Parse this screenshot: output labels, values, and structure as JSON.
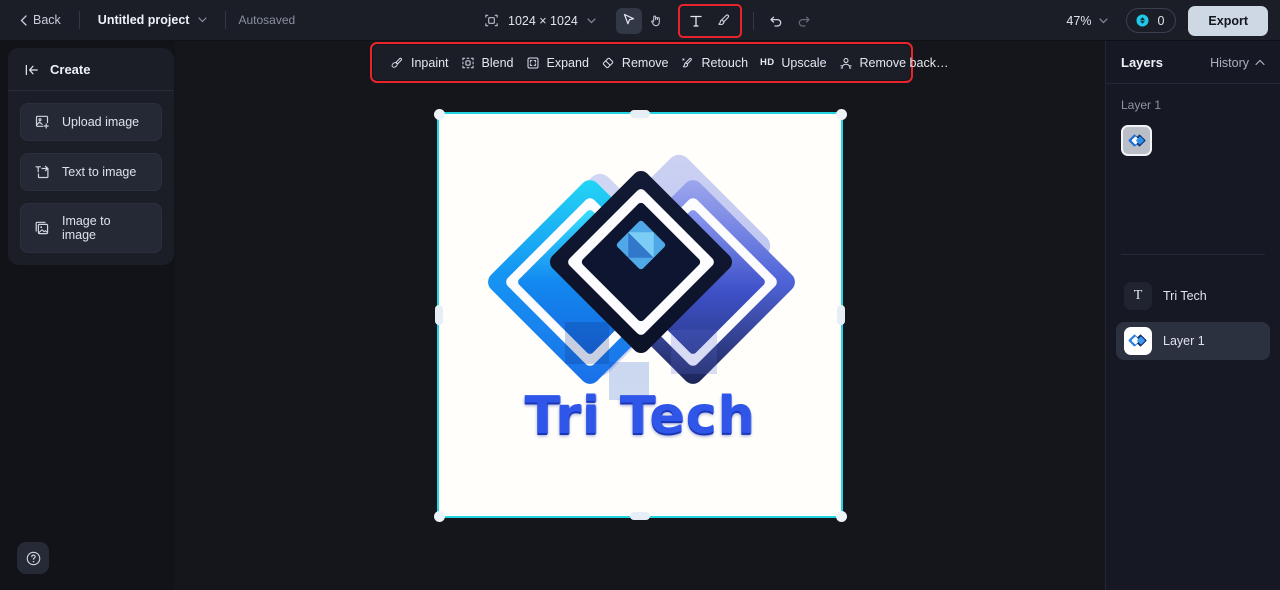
{
  "topbar": {
    "back_label": "Back",
    "project_name": "Untitled project",
    "autosaved_label": "Autosaved",
    "canvas_size": "1024 × 1024",
    "canvas_size_icon": "frame-resize-icon",
    "tools": [
      {
        "name": "select-tool",
        "icon": "cursor-arrow-icon",
        "active": true
      },
      {
        "name": "hand-tool",
        "icon": "hand-icon",
        "active": false
      },
      {
        "name": "text-tool",
        "icon": "text-t-icon",
        "active": false,
        "highlighted": true
      },
      {
        "name": "brush-tool",
        "icon": "paint-brush-icon",
        "active": false,
        "highlighted": true
      },
      {
        "name": "undo-button",
        "icon": "undo-arrow-icon",
        "active": false
      },
      {
        "name": "redo-button",
        "icon": "redo-arrow-icon",
        "active": false,
        "disabled": true
      }
    ],
    "zoom_level": "47%",
    "credits_count": "0",
    "credits_icon": "credit-coin-icon",
    "export_label": "Export",
    "highlight_color": "#e8252a"
  },
  "left_panel": {
    "collapse_icon": "collapse-left-icon",
    "title": "Create",
    "buttons": [
      {
        "label": "Upload image",
        "icon": "image-upload-icon"
      },
      {
        "label": "Text to image",
        "icon": "text-to-image-icon"
      },
      {
        "label": "Image to image",
        "icon": "image-to-image-icon"
      }
    ]
  },
  "action_toolbar": {
    "items": [
      {
        "label": "Inpaint",
        "icon": "inpaint-brush-icon"
      },
      {
        "label": "Blend",
        "icon": "blend-frame-icon"
      },
      {
        "label": "Expand",
        "icon": "expand-frame-icon"
      },
      {
        "label": "Remove",
        "icon": "eraser-icon"
      },
      {
        "label": "Retouch",
        "icon": "retouch-wand-icon"
      },
      {
        "label": "Upscale",
        "icon": "hd-badge-icon",
        "badge": "HD"
      },
      {
        "label": "Remove back…",
        "icon": "remove-background-icon"
      }
    ]
  },
  "canvas": {
    "selection_color": "#22d3e0",
    "rotate_icon": "rotate-icon",
    "artboard_background": "#fffefb",
    "brand_text": "Tri Tech",
    "brand_text_color": "#2f56e8",
    "logo_description": "three overlapping diamonds"
  },
  "right_panel": {
    "tab_layers": "Layers",
    "tab_history": "History",
    "history_chevron_icon": "chevron-up-icon",
    "group_label": "Layer 1",
    "group_thumbnail_icon": "layer-thumbnail-icon",
    "layers": [
      {
        "name": "Tri Tech",
        "icon": "text-layer-icon",
        "selected": false
      },
      {
        "name": "Layer 1",
        "icon": "image-layer-icon",
        "selected": true
      }
    ]
  },
  "help": {
    "icon": "help-question-icon"
  }
}
